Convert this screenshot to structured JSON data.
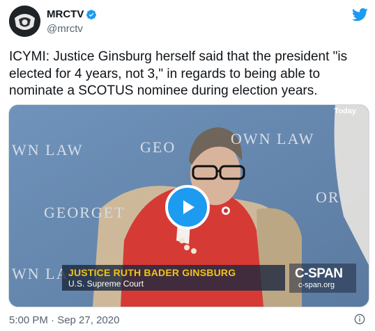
{
  "author": {
    "display_name": "MRCTV",
    "handle": "@mrctv",
    "verified": true
  },
  "tweet": {
    "text": "ICYMI: Justice Ginsburg herself said that the president \"is elected for 4 years, not 3,\" in regards to being able to nominate a SCOTUS nominee during election years.",
    "timestamp": "5:00 PM · Sep 27, 2020"
  },
  "video": {
    "badge": "Today",
    "backdrop_text_left": "WN LAW",
    "backdrop_text_center": "GEO",
    "backdrop_text_right": "OWN LAW",
    "backdrop_text_mid_left": "GEORGET",
    "backdrop_text_mid_right": "OR",
    "backdrop_text_bottom_left": "WN LA",
    "caption_name": "JUSTICE RUTH BADER GINSBURG",
    "caption_title": "U.S. Supreme Court",
    "network": "C-SPAN",
    "network_url": "c-span.org"
  },
  "icons": {
    "bird": "twitter-bird-icon",
    "verified": "verified-badge-icon",
    "play": "play-icon",
    "info": "info-icon"
  },
  "colors": {
    "brand_blue": "#1d9bf0",
    "caption_gold": "#f0c418",
    "muted_text": "#536471"
  }
}
